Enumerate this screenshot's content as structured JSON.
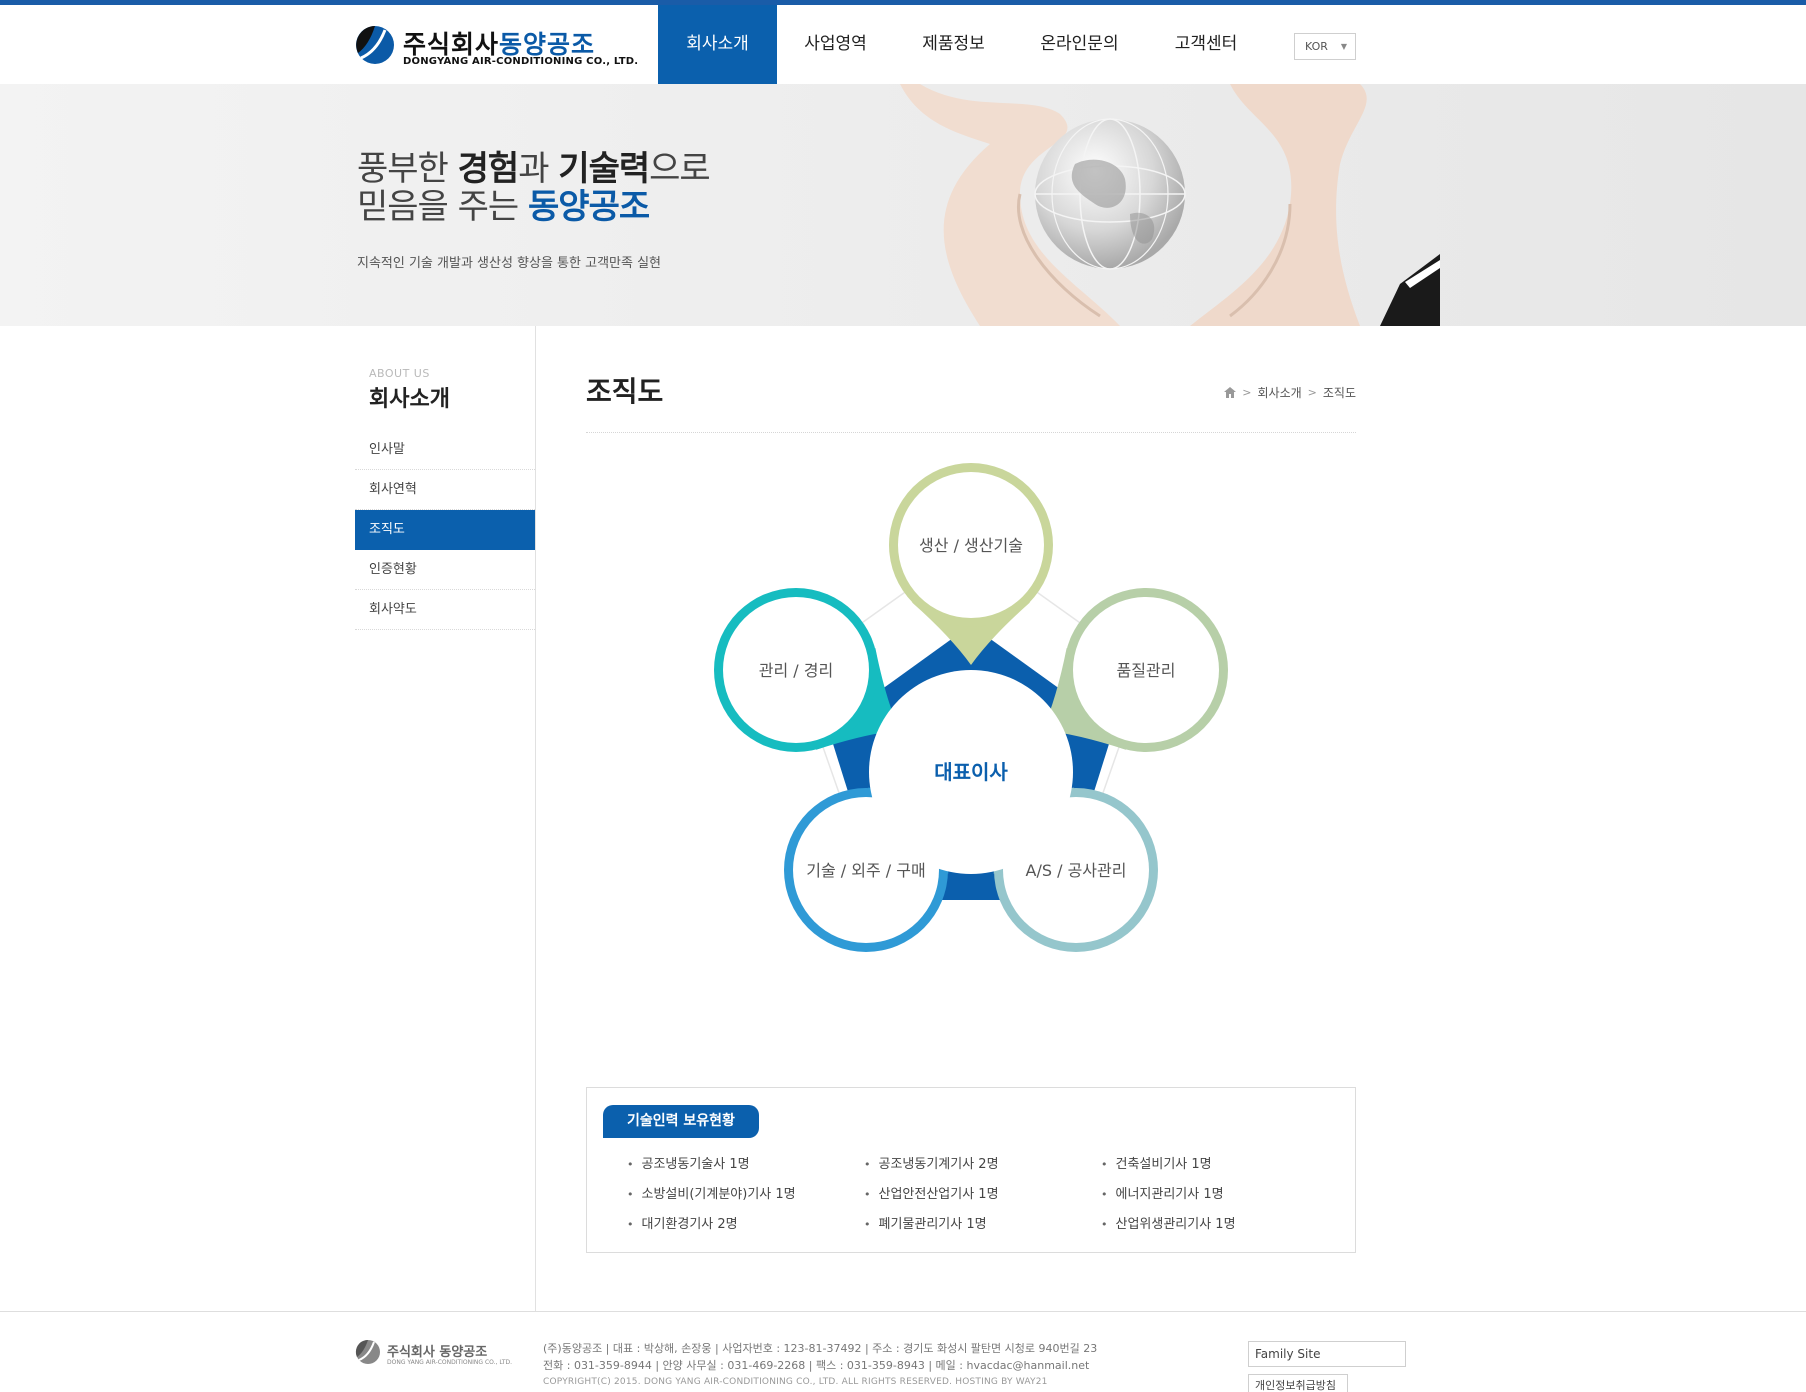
{
  "header": {
    "logo_kr": "주식회사",
    "logo_kr_blue": "동양공조",
    "logo_en": "DONGYANG AIR-CONDITIONING CO., LTD.",
    "nav": [
      {
        "label": "회사소개",
        "active": true
      },
      {
        "label": "사업영역",
        "active": false
      },
      {
        "label": "제품정보",
        "active": false
      },
      {
        "label": "온라인문의",
        "active": false
      },
      {
        "label": "고객센터",
        "active": false
      }
    ],
    "language": "KOR"
  },
  "hero": {
    "line1_a": "풍부한 ",
    "line1_b": "경험",
    "line1_c": "과 ",
    "line1_d": "기술력",
    "line1_e": "으로",
    "line2_a": "믿음을 주는 ",
    "line2_b": "동양공조",
    "subtitle": "지속적인 기술 개발과 생산성 향상을 통한 고객만족 실현"
  },
  "sidebar": {
    "label_en": "ABOUT US",
    "title": "회사소개",
    "items": [
      {
        "label": "인사말",
        "active": false
      },
      {
        "label": "회사연혁",
        "active": false
      },
      {
        "label": "조직도",
        "active": true
      },
      {
        "label": "인증현황",
        "active": false
      },
      {
        "label": "회사약도",
        "active": false
      }
    ]
  },
  "content": {
    "page_title": "조직도",
    "breadcrumb": [
      "회사소개",
      "조직도"
    ]
  },
  "org_chart": {
    "center": "대표이사",
    "nodes": [
      {
        "label": "생산 / 생산기술",
        "color": "#c9d69b"
      },
      {
        "label": "품질관리",
        "color": "#b7cfa8"
      },
      {
        "label": "A/S / 공사관리",
        "color": "#95c6cc"
      },
      {
        "label": "기술 / 외주 / 구매",
        "color": "#2f9ad6"
      },
      {
        "label": "관리 / 경리",
        "color": "#16bcc0"
      }
    ],
    "center_color": "#0b5fad"
  },
  "tech": {
    "title": "기술인력 보유현황",
    "rows": [
      [
        "공조냉동기술사 1명",
        "공조냉동기계기사 2명",
        "건축설비기사 1명"
      ],
      [
        "소방설비(기계분야)기사 1명",
        "산업안전산업기사 1명",
        "에너지관리기사 1명"
      ],
      [
        "대기환경기사 2명",
        "폐기물관리기사 1명",
        "산업위생관리기사 1명"
      ]
    ]
  },
  "footer": {
    "logo_kr": "주식회사 동양공조",
    "logo_en": "DONG YANG AIR-CONDITIONING CO., LTD.",
    "info_line1": "(주)동양공조   |   대표 : 박상해, 손장웅   |   사업자번호 : 123-81-37492   |   주소 : 경기도 화성시 팔탄면 시청로 940번길 23",
    "info_line2": "전화 : 031-359-8944   |   안양 사무실 : 031-469-2268   |   팩스 : 031-359-8943   |   메일 : hvacdac@hanmail.net",
    "copyright": "COPYRIGHT(C) 2015. DONG YANG AIR-CONDITIONING CO., LTD. ALL RIGHTS RESERVED.  HOSTING BY WAY21",
    "family_site": "Family Site",
    "privacy": "개인정보취급방침"
  }
}
